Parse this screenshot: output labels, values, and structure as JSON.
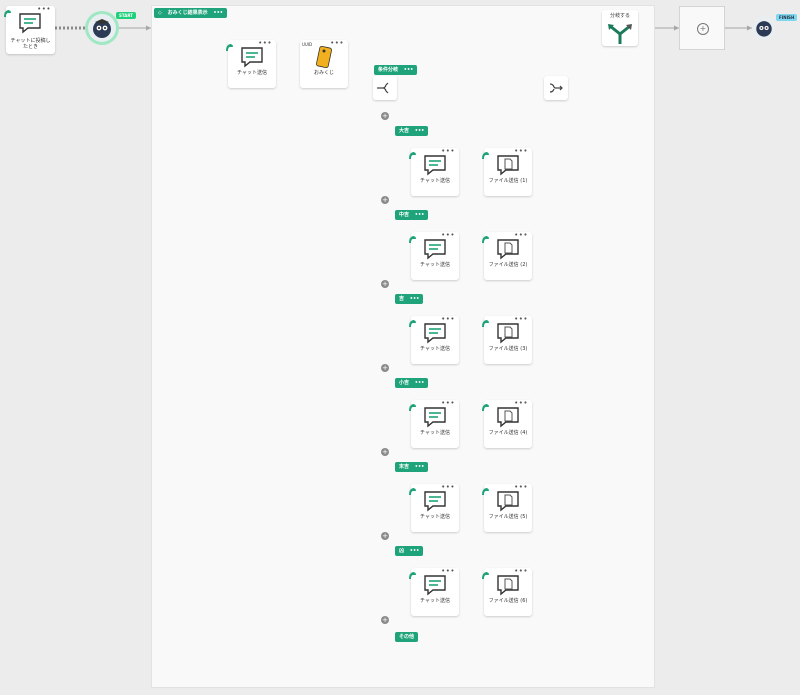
{
  "colors": {
    "accent": "#1fa37a",
    "canvas": "#ececec",
    "panel": "#f9f9f9",
    "line": "#9e9e9e"
  },
  "trigger": {
    "label": "チャットに投稿したとき",
    "icon": "chat-bubble-icon"
  },
  "start_badge": "START",
  "end_badge": "FINISH",
  "group": {
    "title": "おみくじ結果表示",
    "menu": "•••"
  },
  "node_menu": "•••",
  "chat_node": {
    "label": "チャット送信"
  },
  "omikuji_node": {
    "label": "おみくじ"
  },
  "branch": {
    "title": "条件分岐",
    "menu": "•••"
  },
  "merge_label": "",
  "split_node": {
    "label": "分岐する"
  },
  "branches": [
    {
      "title": "大吉",
      "chat_label": "チャット送信",
      "file_label": "ファイル送信 (1)"
    },
    {
      "title": "中吉",
      "chat_label": "チャット送信",
      "file_label": "ファイル送信 (2)"
    },
    {
      "title": "吉",
      "chat_label": "チャット送信",
      "file_label": "ファイル送信 (3)"
    },
    {
      "title": "小吉",
      "chat_label": "チャット送信",
      "file_label": "ファイル送信 (4)"
    },
    {
      "title": "末吉",
      "chat_label": "チャット送信",
      "file_label": "ファイル送信 (5)"
    },
    {
      "title": "凶",
      "chat_label": "チャット送信",
      "file_label": "ファイル送信 (6)"
    }
  ],
  "else_branch": {
    "title": "その他"
  },
  "add_symbol": "+"
}
